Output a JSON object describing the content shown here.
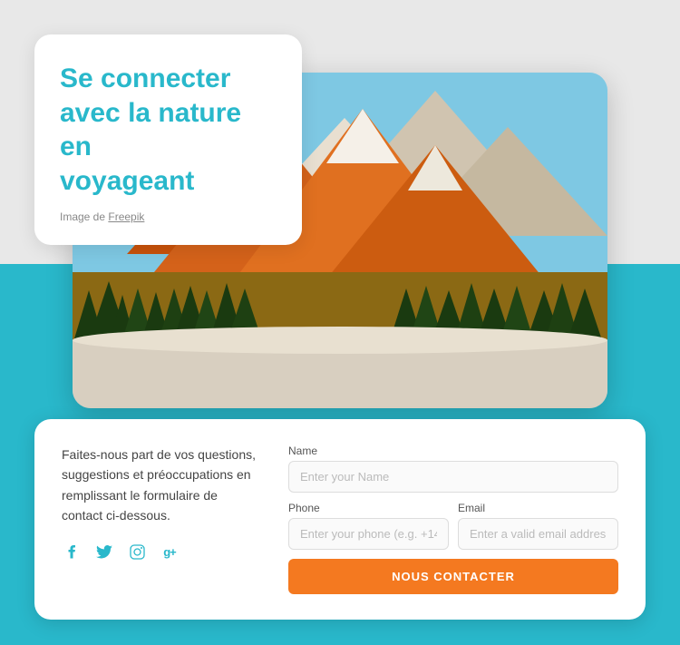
{
  "page": {
    "background_color": "#e8e8e8",
    "teal_color": "#29b8cb"
  },
  "title_card": {
    "heading_line1": "Se connecter",
    "heading_line2": "avec la nature en",
    "heading_line3": "voyageant",
    "image_credit_prefix": "Image de ",
    "image_credit_link": "Freepik"
  },
  "contact_card": {
    "description": "Faites-nous part de vos questions, suggestions et préoccupations en remplissant le formulaire de contact ci-dessous.",
    "social_icons": [
      {
        "name": "facebook",
        "symbol": "f"
      },
      {
        "name": "twitter",
        "symbol": "t"
      },
      {
        "name": "instagram",
        "symbol": "i"
      },
      {
        "name": "google-plus",
        "symbol": "g+"
      }
    ],
    "form": {
      "name_label": "Name",
      "name_placeholder": "Enter your Name",
      "phone_label": "Phone",
      "phone_placeholder": "Enter your phone (e.g. +14",
      "email_label": "Email",
      "email_placeholder": "Enter a valid email addres",
      "submit_label": "NOUS CONTACTER"
    }
  }
}
